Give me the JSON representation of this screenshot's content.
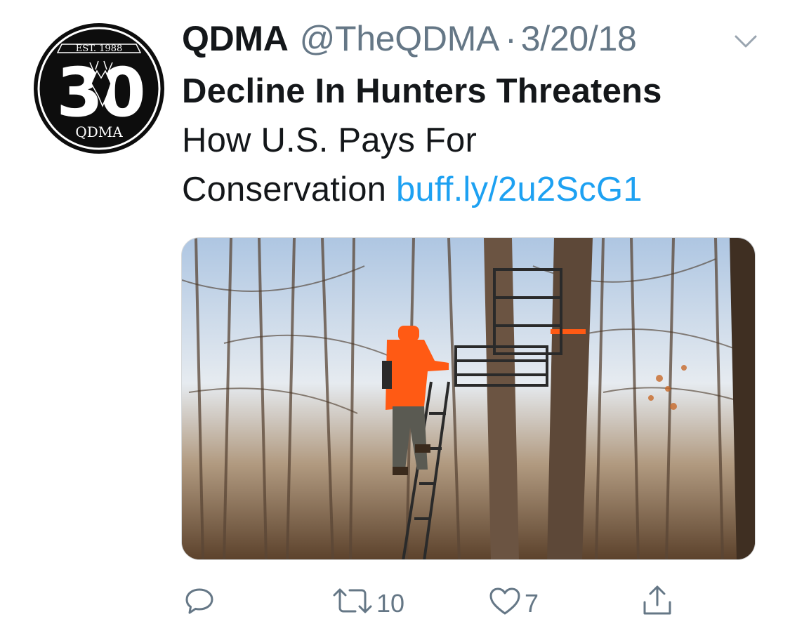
{
  "tweet": {
    "display_name": "QDMA",
    "handle": "@TheQDMA",
    "separator": "·",
    "date": "3/20/18",
    "text_line1": "Decline In Hunters Threatens",
    "text_line2": "How U.S. Pays For",
    "text_line3": "Conservation",
    "link": "buff.ly/2u2ScG1"
  },
  "avatar": {
    "logo_top": "EST. 1988",
    "logo_number": "30",
    "logo_bottom": "QDMA"
  },
  "actions": {
    "reply_icon": "reply-icon",
    "retweet_icon": "retweet-icon",
    "retweet_count": "10",
    "like_icon": "heart-icon",
    "like_count": "7",
    "share_icon": "share-icon"
  },
  "colors": {
    "text": "#14171a",
    "secondary": "#657786",
    "link": "#1da1f2",
    "hunter_orange": "#ff5a14"
  }
}
